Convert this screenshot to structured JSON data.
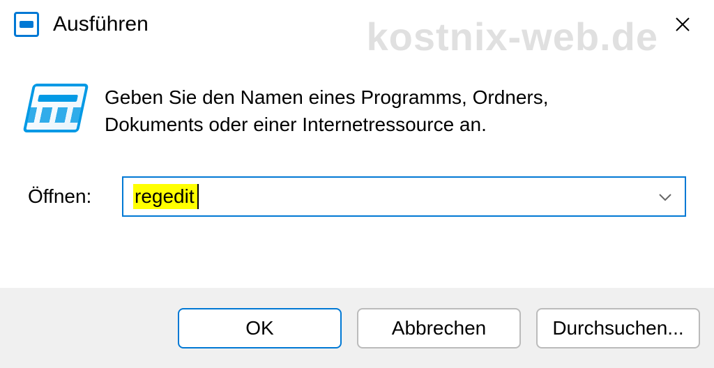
{
  "window": {
    "title": "Ausführen",
    "watermark": "kostnix-web.de",
    "instruction": "Geben Sie den Namen eines Programms, Ordners, Dokuments oder einer Internetressource an.",
    "open_label": "Öffnen:",
    "input_value": "regedit"
  },
  "buttons": {
    "ok": "OK",
    "cancel": "Abbrechen",
    "browse": "Durchsuchen..."
  }
}
